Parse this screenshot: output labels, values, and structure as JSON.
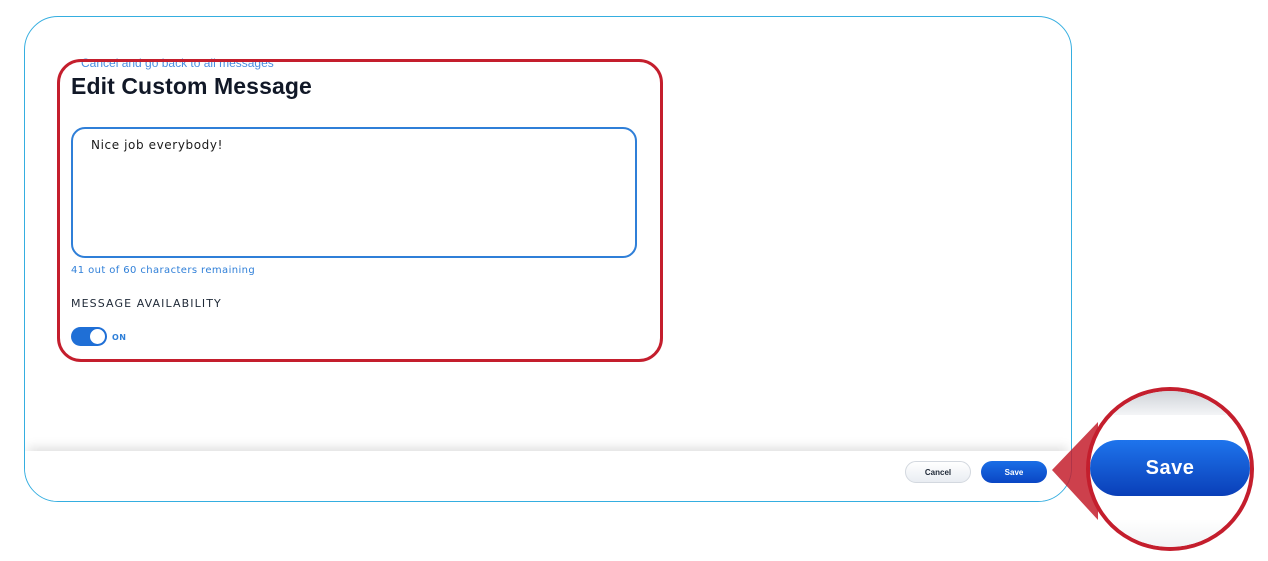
{
  "nav": {
    "back_link": "Cancel and go back to all messages"
  },
  "form": {
    "title": "Edit Custom Message",
    "message_value": "Nice job everybody!",
    "char_counter": "41 out of 60 characters remaining",
    "availability_heading": "MESSAGE AVAILABILITY",
    "toggle_label": "ON",
    "toggle_on": true
  },
  "footer": {
    "cancel_label": "Cancel",
    "save_label": "Save"
  },
  "callout": {
    "zoom_label": "Save"
  },
  "colors": {
    "accent": "#2f7fd8",
    "primary_button": "#0a46c4",
    "highlight": "#c41e2d",
    "panel_border": "#35aee0"
  }
}
